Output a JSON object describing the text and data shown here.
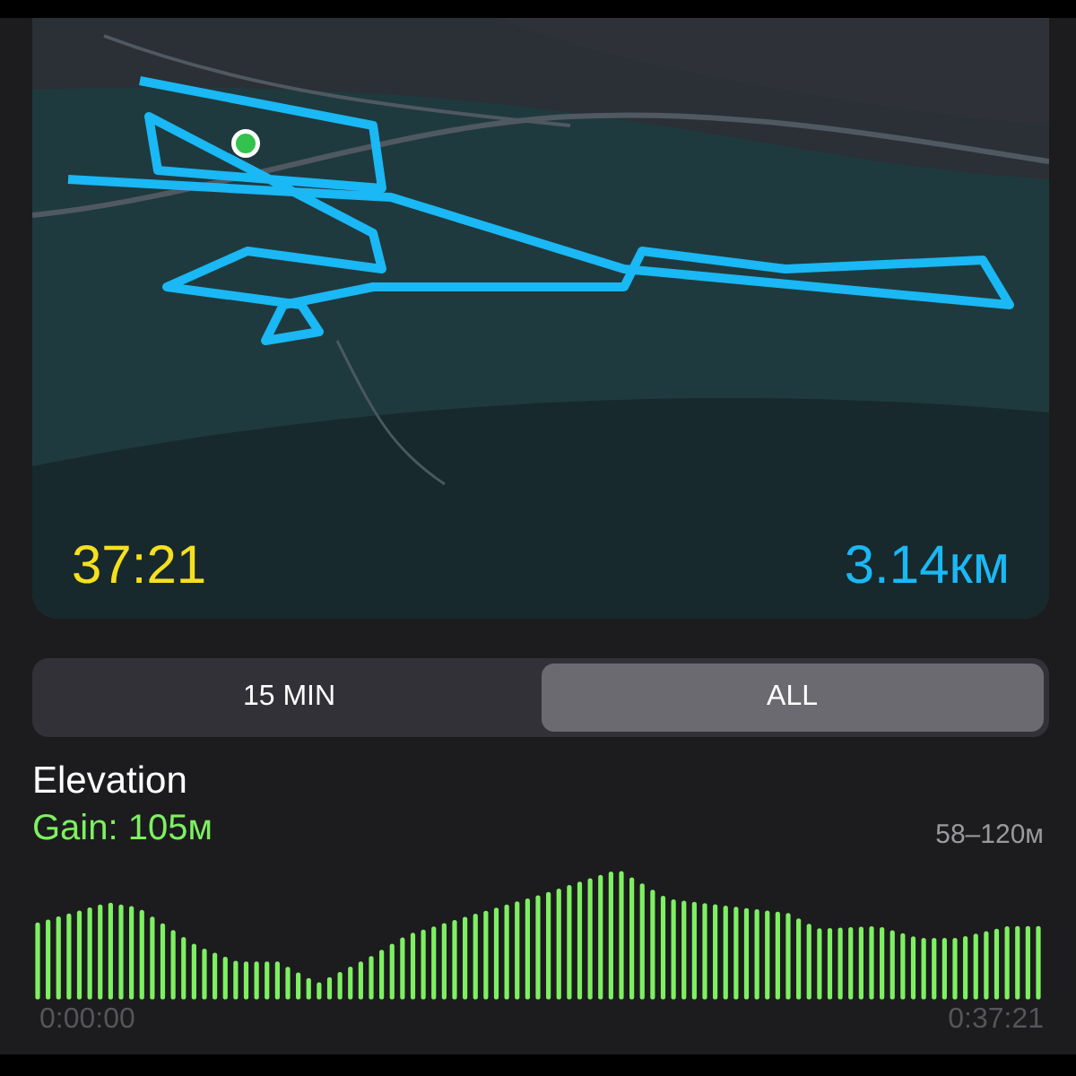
{
  "map": {
    "kind": "picture",
    "duration": "37:21",
    "distance": "3.14км"
  },
  "segments": [
    {
      "label": "15 MIN",
      "selected": false
    },
    {
      "label": "ALL",
      "selected": true
    }
  ],
  "elevation": {
    "title": "Elevation",
    "gain": "Gain: 105м",
    "range": "58–120м",
    "start_time": "0:00:00",
    "end_time": "0:37:21"
  }
}
